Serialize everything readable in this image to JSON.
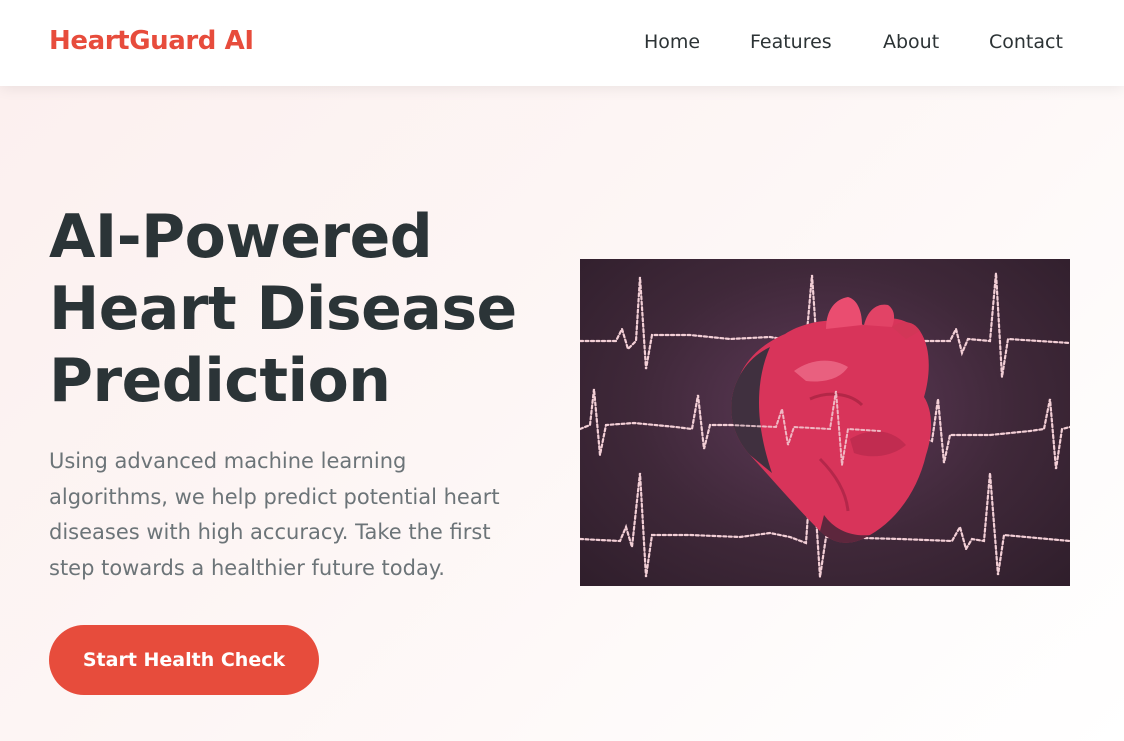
{
  "brand": {
    "name": "HeartGuard AI"
  },
  "nav": {
    "items": [
      {
        "label": "Home"
      },
      {
        "label": "Features"
      },
      {
        "label": "About"
      },
      {
        "label": "Contact"
      }
    ]
  },
  "hero": {
    "title_lines": [
      "AI-Powered",
      "Heart Disease",
      "Prediction"
    ],
    "description_lines": [
      "Using advanced machine learning",
      "algorithms, we help predict potential heart",
      "diseases with high accuracy. Take the first",
      "step towards a healthier future today."
    ],
    "cta_label": "Start Health Check",
    "image": {
      "subject": "anatomical-heart-with-ecg-lines"
    }
  },
  "colors": {
    "accent": "#e74c3c",
    "heading": "#2b3437",
    "body_text": "#6c7478",
    "nav_text": "#2c3335",
    "image_background": "#3f2839",
    "heart": "#d8345a",
    "ecg_line": "#f3cfd6"
  }
}
